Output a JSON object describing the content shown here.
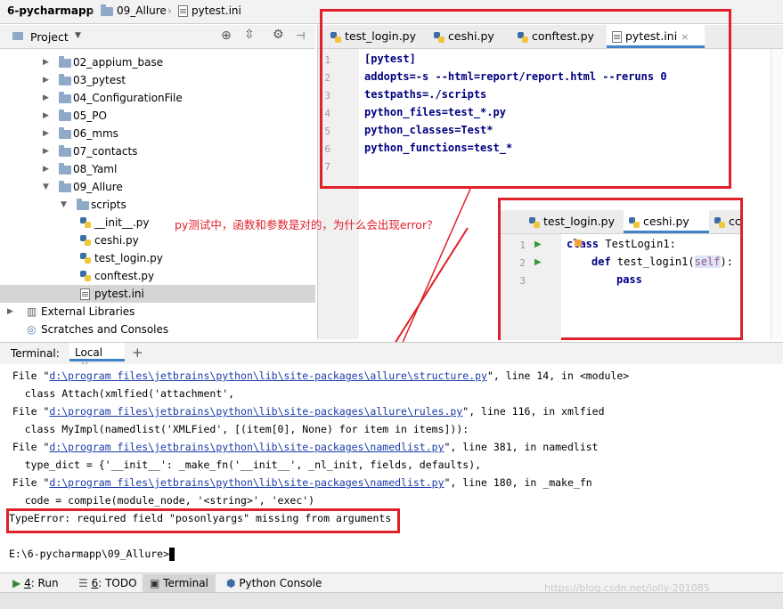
{
  "breadcrumb": {
    "project": "6-pycharmapp",
    "folder": "09_Allure",
    "file": "pytest.ini"
  },
  "project_panel": {
    "title": "Project",
    "tree": [
      {
        "label": "02_appium_base",
        "type": "folder",
        "level": 1,
        "collapsed": true
      },
      {
        "label": "03_pytest",
        "type": "folder",
        "level": 1,
        "collapsed": true
      },
      {
        "label": "04_ConfigurationFile",
        "type": "folder",
        "level": 1,
        "collapsed": true
      },
      {
        "label": "05_PO",
        "type": "folder",
        "level": 1,
        "collapsed": true
      },
      {
        "label": "06_mms",
        "type": "folder",
        "level": 1,
        "collapsed": true
      },
      {
        "label": "07_contacts",
        "type": "folder",
        "level": 1,
        "collapsed": true
      },
      {
        "label": "08_Yaml",
        "type": "folder",
        "level": 1,
        "collapsed": true
      },
      {
        "label": "09_Allure",
        "type": "folder",
        "level": 1,
        "collapsed": false
      },
      {
        "label": "scripts",
        "type": "folder",
        "level": 2,
        "collapsed": false
      },
      {
        "label": "__init__.py",
        "type": "py",
        "level": 3
      },
      {
        "label": "ceshi.py",
        "type": "py",
        "level": 3
      },
      {
        "label": "test_login.py",
        "type": "py",
        "level": 3
      },
      {
        "label": "conftest.py",
        "type": "py",
        "level": 2
      },
      {
        "label": "pytest.ini",
        "type": "ini",
        "level": 2,
        "selected": true
      },
      {
        "label": "External Libraries",
        "type": "lib",
        "level": 0,
        "collapsed": true
      },
      {
        "label": "Scratches and Consoles",
        "type": "scratch",
        "level": 0
      }
    ]
  },
  "editor": {
    "tabs": [
      {
        "label": "test_login.py"
      },
      {
        "label": "ceshi.py"
      },
      {
        "label": "conftest.py"
      },
      {
        "label": "pytest.ini",
        "active": true
      }
    ],
    "line_numbers": [
      "1",
      "2",
      "3",
      "4",
      "5",
      "6",
      "7"
    ],
    "lines": [
      "[pytest]",
      "addopts=-s --html=report/report.html --reruns 0",
      "testpaths=./scripts",
      "python_files=test_*.py",
      "python_classes=Test*",
      "python_functions=test_*",
      ""
    ]
  },
  "inset": {
    "tabs": [
      {
        "label": "test_login.py"
      },
      {
        "label": "ceshi.py",
        "active": true
      },
      {
        "label": "cc"
      }
    ],
    "line_numbers": [
      "1",
      "2",
      "3"
    ],
    "line1_kw": "class",
    "line1_name": " TestLogin1:",
    "line2_kw": "def",
    "line2_name": " test_login1(",
    "line2_self": "self",
    "line2_end": "):",
    "line3": "pass"
  },
  "annotation": "py测试中，函数和参数是对的，为什么会出现error？",
  "terminal": {
    "title": "Terminal:",
    "tab": "Local",
    "close": "×",
    "add": "+",
    "lines": [
      {
        "pre": "  File \"",
        "link": "d:\\program files\\jetbrains\\python\\lib\\site-packages\\allure\\structure.py",
        "post": "\", line 14, in <module>"
      },
      {
        "pre": "    class Attach(xmlfied('attachment',",
        "link": "",
        "post": ""
      },
      {
        "pre": "  File \"",
        "link": "d:\\program files\\jetbrains\\python\\lib\\site-packages\\allure\\rules.py",
        "post": "\", line 116, in xmlfied"
      },
      {
        "pre": "    class MyImpl(namedlist('XMLFied', [(item[0], None) for item in items])):",
        "link": "",
        "post": ""
      },
      {
        "pre": "  File \"",
        "link": "d:\\program files\\jetbrains\\python\\lib\\site-packages\\namedlist.py",
        "post": "\", line 381, in namedlist"
      },
      {
        "pre": "    type_dict = {'__init__': _make_fn('__init__', _nl_init, fields, defaults),",
        "link": "",
        "post": ""
      },
      {
        "pre": "  File \"",
        "link": "d:\\program files\\jetbrains\\python\\lib\\site-packages\\namedlist.py",
        "post": "\", line 180, in _make_fn"
      },
      {
        "pre": "    code = compile(module_node, '<string>', 'exec')",
        "link": "",
        "post": ""
      },
      {
        "pre": "TypeError: required field \"posonlyargs\" missing from arguments",
        "link": "",
        "post": ""
      },
      {
        "pre": "",
        "link": "",
        "post": ""
      },
      {
        "pre": "E:\\6-pycharmapp\\09_Allure>",
        "link": "",
        "post": ""
      }
    ]
  },
  "statusbar": {
    "run_num": "4",
    "run": ": Run",
    "todo_num": "6",
    "todo": ": TODO",
    "terminal": "Terminal",
    "python_console": "Python Console"
  },
  "watermark": "https://blog.csdn.net/jolly-201085"
}
